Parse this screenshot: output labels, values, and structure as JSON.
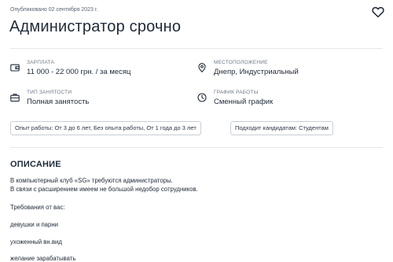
{
  "vacancy": {
    "published": "Опубликовано 02 сентября 2023 г.",
    "title": "Администратор срочно"
  },
  "facts": {
    "salary": {
      "label": "ЗАРПЛАТА",
      "value": "11 000 - 22 000 грн. / за месяц",
      "icon": "wallet-icon"
    },
    "location": {
      "label": "МЕСТОПОЛОЖЕНИЕ",
      "value": "Днепр, Индустриальный",
      "icon": "location-pin-icon"
    },
    "employment": {
      "label": "ТИП ЗАНЯТОСТИ",
      "value": "Полная занятость",
      "icon": "briefcase-icon"
    },
    "schedule": {
      "label": "ГРАФИК РАБОТЫ",
      "value": "Сменный график",
      "icon": "clock-icon"
    }
  },
  "tags": [
    "Опыт работы: От 3 до 6 лет, Без опыта работы, От 1 года до 3 лет",
    "Подходит кандидатам: Студентам"
  ],
  "description": {
    "heading": "ОПИСАНИЕ",
    "lines": [
      "В компьютерный клуб «SG» требуются администраторы.",
      "В связи с расширением имеем не большой недобор сотрудников.",
      "Требования от вас:",
      "девушки и парни",
      "ухоженный вн.вид",
      "желание зарабатывать"
    ]
  }
}
